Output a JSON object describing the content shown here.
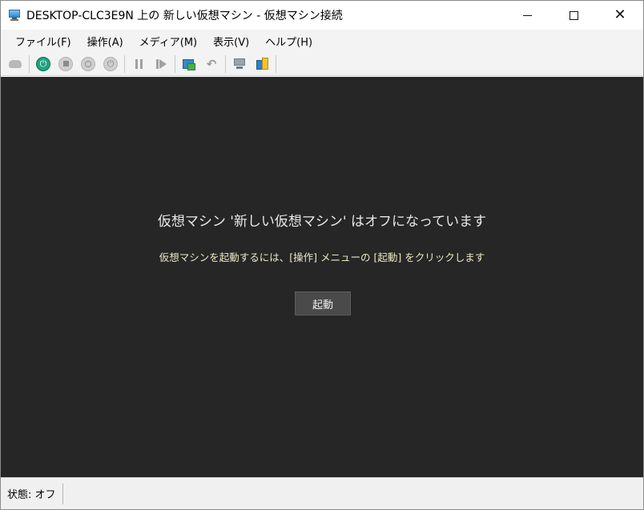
{
  "window": {
    "title": "DESKTOP-CLC3E9N 上の 新しい仮想マシン - 仮想マシン接続"
  },
  "menu": {
    "items": [
      {
        "label": "ファイル(F)"
      },
      {
        "label": "操作(A)"
      },
      {
        "label": "メディア(M)"
      },
      {
        "label": "表示(V)"
      },
      {
        "label": "ヘルプ(H)"
      }
    ]
  },
  "content": {
    "headline": "仮想マシン '新しい仮想マシン' はオフになっています",
    "subline": "仮想マシンを起動するには、[操作] メニューの [起動] をクリックします",
    "start_button_label": "起動"
  },
  "status": {
    "text": "状態: オフ"
  },
  "colors": {
    "content_background": "#262626",
    "start_icon_green": "#1fa37f",
    "subline_text": "#ece9c6"
  }
}
